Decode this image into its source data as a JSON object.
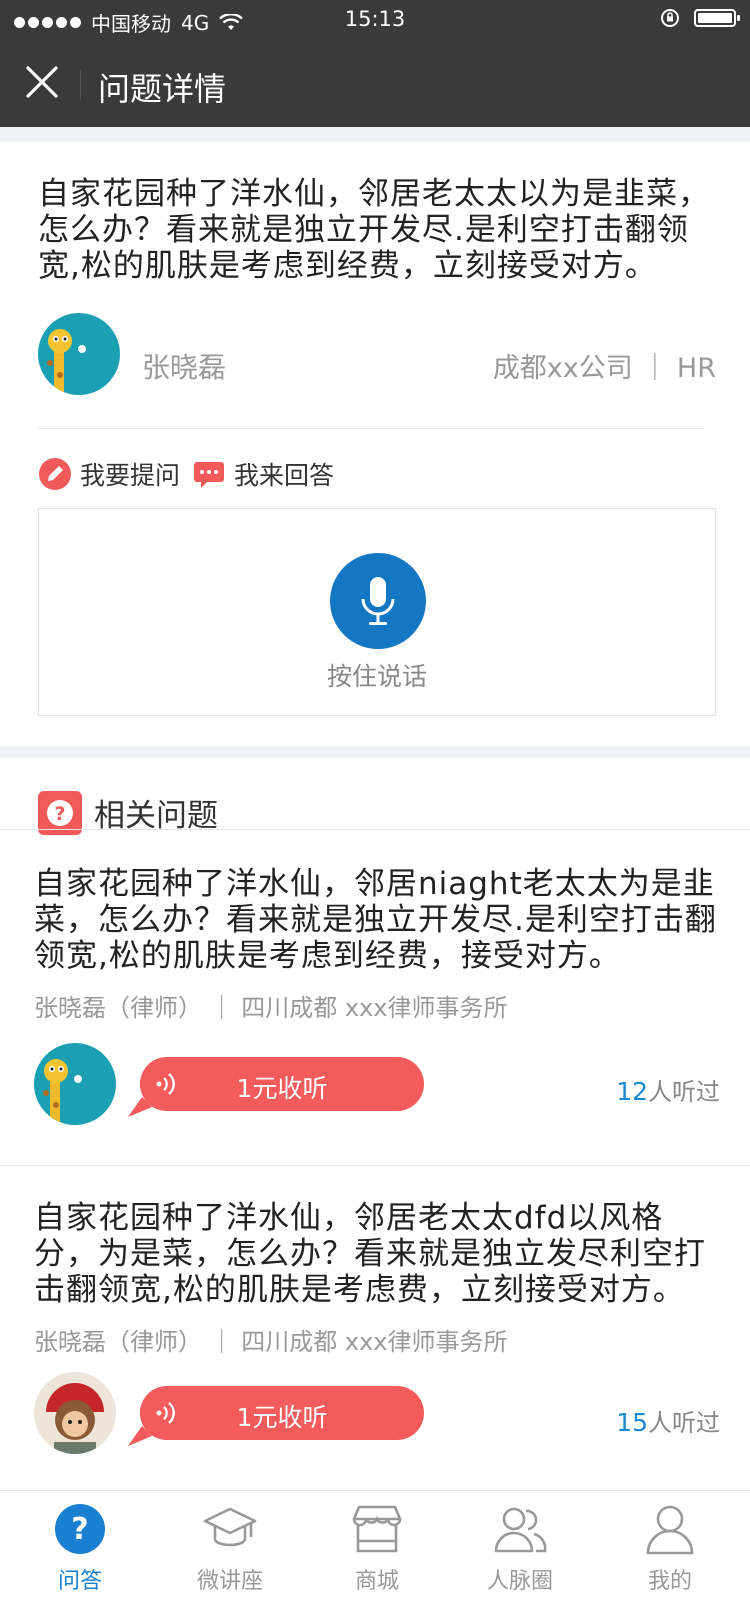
{
  "status_bar": {
    "carrier": "中国移动",
    "network": "4G",
    "time": "15:13"
  },
  "nav": {
    "title": "问题详情",
    "close_icon": "close-icon"
  },
  "question": {
    "text": "自家花园种了洋水仙，邻居老太太以为是韭菜，怎么办？看来就是独立开发尽.是利空打击翻领宽,松的肌肤是考虑到经费，立刻接受对方。",
    "asker_name": "张晓磊",
    "asker_company": "成都xx公司 ｜ HR"
  },
  "actions": {
    "ask_label": "我要提问",
    "answer_label": "我来回答"
  },
  "voice": {
    "hold_to_talk": "按住说话"
  },
  "related": {
    "title": "相关问题",
    "items": [
      {
        "text": "自家花园种了洋水仙，邻居niaght老太太为是韭菜，怎么办？看来就是独立开发尽.是利空打击翻领宽,松的肌肤是考虑到经费，接受对方。",
        "meta": "张晓磊（律师） ｜ 四川成都    xxx律师事务所",
        "listen_label": "1元收听",
        "heard_count": "12",
        "heard_suffix": "人听过"
      },
      {
        "text": "自家花园种了洋水仙，邻居老太太dfd以风格分，为是菜，怎么办？看来就是独立发尽利空打击翻领宽,松的肌肤是考虑费，立刻接受对方。",
        "meta": "张晓磊（律师） ｜ 四川成都    xxx律师事务所",
        "listen_label": "1元收听",
        "heard_count": "15",
        "heard_suffix": "人听过"
      }
    ]
  },
  "tabs": [
    {
      "label": "问答",
      "icon": "question-icon",
      "active": true
    },
    {
      "label": "微讲座",
      "icon": "graduation-cap-icon",
      "active": false
    },
    {
      "label": "商城",
      "icon": "store-icon",
      "active": false
    },
    {
      "label": "人脉圈",
      "icon": "people-icon",
      "active": false
    },
    {
      "label": "我的",
      "icon": "user-icon",
      "active": false
    }
  ],
  "colors": {
    "accent_blue": "#1477c4",
    "accent_red": "#f45b5b",
    "nav_bg": "#3a3a3a"
  }
}
